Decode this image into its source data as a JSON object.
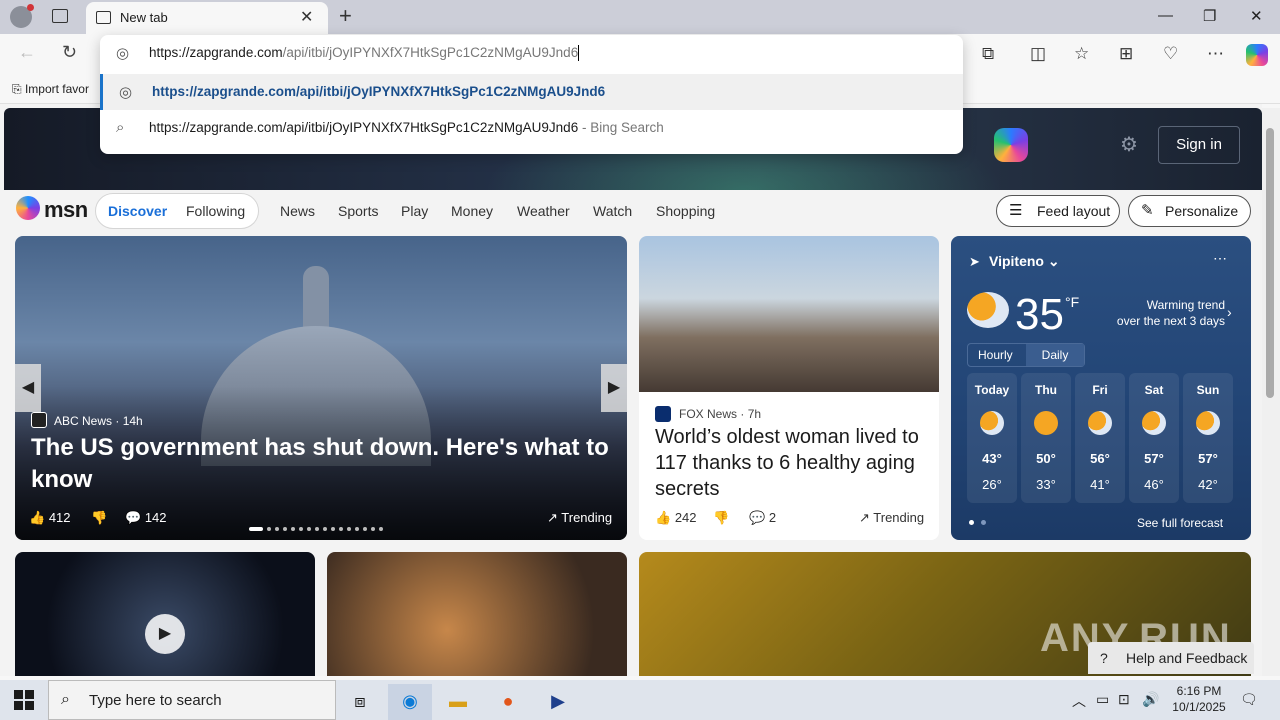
{
  "browser": {
    "tab_title": "New tab",
    "tab_close": "✕",
    "new_tab": "+",
    "window_buttons": {
      "minimize": "—",
      "restore": "❐",
      "close": "✕"
    },
    "address": {
      "typed": "https://zapgrande.com/api/itbi/jOyIPYNXfX7HtkSgPc1C2zNMgAU9Jnd6",
      "typed_host": "https://zapgrande.com",
      "typed_path": "/api/itbi/jOyIPYNXfX7HtkSgPc1C2zNMgAU9Jnd6",
      "suggestions": [
        {
          "text": "https://zapgrande.com/api/itbi/jOyIPYNXfX7HtkSgPc1C2zNMgAU9Jnd6",
          "icon": "globe-icon"
        },
        {
          "text": "https://zapgrande.com/api/itbi/jOyIPYNXfX7HtkSgPc1C2zNMgAU9Jnd6",
          "suffix": "- Bing Search",
          "icon": "search-icon"
        }
      ]
    },
    "favorites_import": "Import favor"
  },
  "msn": {
    "logo_text": "msn",
    "sign_in": "Sign in",
    "feed_tabs": {
      "discover": "Discover",
      "following": "Following"
    },
    "nav": [
      "News",
      "Sports",
      "Play",
      "Money",
      "Weather",
      "Watch",
      "Shopping"
    ],
    "feed_layout": "Feed layout",
    "personalize": "Personalize"
  },
  "hero": {
    "source": "ABC News",
    "age": "14h",
    "title": "The US government has shut down. Here's what to know",
    "likes": "412",
    "comments": "142",
    "trending": "Trending"
  },
  "story2": {
    "source": "FOX News",
    "age": "7h",
    "title": "World’s oldest woman lived to 117 thanks to 6 healthy aging secrets",
    "likes": "242",
    "comments": "2",
    "trending": "Trending"
  },
  "weather": {
    "location": "Vipiteno",
    "temp": "35",
    "unit": "°F",
    "trend_line1": "Warming trend",
    "trend_line2": "over the next 3 days",
    "hourly": "Hourly",
    "daily": "Daily",
    "days": [
      {
        "day": "Today",
        "hi": "43°",
        "lo": "26°",
        "icon": "partly-cloudy-icon"
      },
      {
        "day": "Thu",
        "hi": "50°",
        "lo": "33°",
        "icon": "sunny-icon"
      },
      {
        "day": "Fri",
        "hi": "56°",
        "lo": "41°",
        "icon": "partly-cloudy-icon"
      },
      {
        "day": "Sat",
        "hi": "57°",
        "lo": "46°",
        "icon": "partly-cloudy-icon"
      },
      {
        "day": "Sun",
        "hi": "57°",
        "lo": "42°",
        "icon": "partly-cloudy-icon"
      }
    ],
    "see_full": "See full forecast"
  },
  "help": "Help and Feedback",
  "watermark": "ANY.RUN",
  "taskbar": {
    "search_placeholder": "Type here to search",
    "time": "6:16 PM",
    "date": "10/1/2025"
  },
  "colors": {
    "accent": "#1a6fd8",
    "taskbar": "#dfe4ec",
    "weather_bg": "#234677"
  }
}
